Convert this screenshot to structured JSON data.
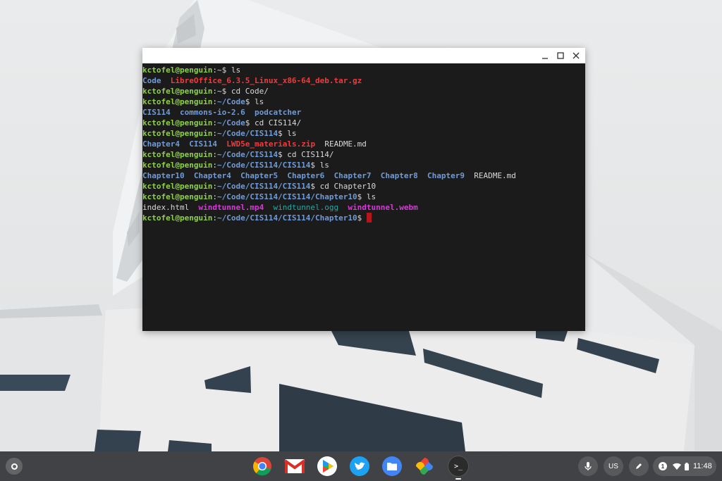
{
  "terminal": {
    "lines": [
      [
        {
          "t": "kctofel@penguin",
          "c": "u"
        },
        {
          "t": ":~$ ls",
          "c": "txt"
        }
      ],
      [
        {
          "t": "Code",
          "c": "dir"
        },
        {
          "t": "  ",
          "c": "txt"
        },
        {
          "t": "LibreOffice_6.3.5_Linux_x86-64_deb.tar.gz",
          "c": "arc"
        }
      ],
      [
        {
          "t": "kctofel@penguin",
          "c": "u"
        },
        {
          "t": ":~$ cd Code/",
          "c": "txt"
        }
      ],
      [
        {
          "t": "kctofel@penguin",
          "c": "u"
        },
        {
          "t": ":",
          "c": "txt"
        },
        {
          "t": "~/Code",
          "c": "p"
        },
        {
          "t": "$ ls",
          "c": "txt"
        }
      ],
      [
        {
          "t": "CIS114",
          "c": "dir"
        },
        {
          "t": "  ",
          "c": "txt"
        },
        {
          "t": "commons-io-2.6",
          "c": "dir"
        },
        {
          "t": "  ",
          "c": "txt"
        },
        {
          "t": "podcatcher",
          "c": "dir"
        }
      ],
      [
        {
          "t": "kctofel@penguin",
          "c": "u"
        },
        {
          "t": ":",
          "c": "txt"
        },
        {
          "t": "~/Code",
          "c": "p"
        },
        {
          "t": "$ cd CIS114/",
          "c": "txt"
        }
      ],
      [
        {
          "t": "kctofel@penguin",
          "c": "u"
        },
        {
          "t": ":",
          "c": "txt"
        },
        {
          "t": "~/Code/CIS114",
          "c": "p"
        },
        {
          "t": "$ ls",
          "c": "txt"
        }
      ],
      [
        {
          "t": "Chapter4",
          "c": "dir"
        },
        {
          "t": "  ",
          "c": "txt"
        },
        {
          "t": "CIS114",
          "c": "dir"
        },
        {
          "t": "  ",
          "c": "txt"
        },
        {
          "t": "LWD5e_materials.zip",
          "c": "arc"
        },
        {
          "t": "  README.md",
          "c": "txt"
        }
      ],
      [
        {
          "t": "kctofel@penguin",
          "c": "u"
        },
        {
          "t": ":",
          "c": "txt"
        },
        {
          "t": "~/Code/CIS114",
          "c": "p"
        },
        {
          "t": "$ cd CIS114/",
          "c": "txt"
        }
      ],
      [
        {
          "t": "kctofel@penguin",
          "c": "u"
        },
        {
          "t": ":",
          "c": "txt"
        },
        {
          "t": "~/Code/CIS114/CIS114",
          "c": "p"
        },
        {
          "t": "$ ls",
          "c": "txt"
        }
      ],
      [
        {
          "t": "Chapter10",
          "c": "dir"
        },
        {
          "t": "  ",
          "c": "txt"
        },
        {
          "t": "Chapter4",
          "c": "dir"
        },
        {
          "t": "  ",
          "c": "txt"
        },
        {
          "t": "Chapter5",
          "c": "dir"
        },
        {
          "t": "  ",
          "c": "txt"
        },
        {
          "t": "Chapter6",
          "c": "dir"
        },
        {
          "t": "  ",
          "c": "txt"
        },
        {
          "t": "Chapter7",
          "c": "dir"
        },
        {
          "t": "  ",
          "c": "txt"
        },
        {
          "t": "Chapter8",
          "c": "dir"
        },
        {
          "t": "  ",
          "c": "txt"
        },
        {
          "t": "Chapter9",
          "c": "dir"
        },
        {
          "t": "  README.md",
          "c": "txt"
        }
      ],
      [
        {
          "t": "kctofel@penguin",
          "c": "u"
        },
        {
          "t": ":",
          "c": "txt"
        },
        {
          "t": "~/Code/CIS114/CIS114",
          "c": "p"
        },
        {
          "t": "$ cd Chapter10",
          "c": "txt"
        }
      ],
      [
        {
          "t": "kctofel@penguin",
          "c": "u"
        },
        {
          "t": ":",
          "c": "txt"
        },
        {
          "t": "~/Code/CIS114/CIS114/Chapter10",
          "c": "p"
        },
        {
          "t": "$ ls",
          "c": "txt"
        }
      ],
      [
        {
          "t": "index.html",
          "c": "txt"
        },
        {
          "t": "  ",
          "c": "txt"
        },
        {
          "t": "windtunnel.mp4",
          "c": "med"
        },
        {
          "t": "  ",
          "c": "txt"
        },
        {
          "t": "windtunnel.ogg",
          "c": "ogg"
        },
        {
          "t": "  ",
          "c": "txt"
        },
        {
          "t": "windtunnel.webm",
          "c": "med"
        }
      ],
      [
        {
          "t": "kctofel@penguin",
          "c": "u"
        },
        {
          "t": ":",
          "c": "txt"
        },
        {
          "t": "~/Code/CIS114/CIS114/Chapter10",
          "c": "p"
        },
        {
          "t": "$ ",
          "c": "txt"
        }
      ]
    ],
    "colors": {
      "user": "#8ed04a",
      "path": "#6f9bd6",
      "archive": "#ef3b3b",
      "media": "#d63ad6",
      "audio": "#2aa5a5",
      "cursor": "#b3161b"
    }
  },
  "window_controls": [
    "minimize-icon",
    "maximize-icon",
    "close-icon"
  ],
  "shelf": {
    "apps": [
      "chrome-icon",
      "gmail-icon",
      "play-store-icon",
      "twitter-icon",
      "files-icon",
      "photos-icon",
      "terminal-icon"
    ],
    "terminal_glyph": ">_",
    "ime_label": "US",
    "notification_count": "1",
    "clock": "11:48"
  }
}
